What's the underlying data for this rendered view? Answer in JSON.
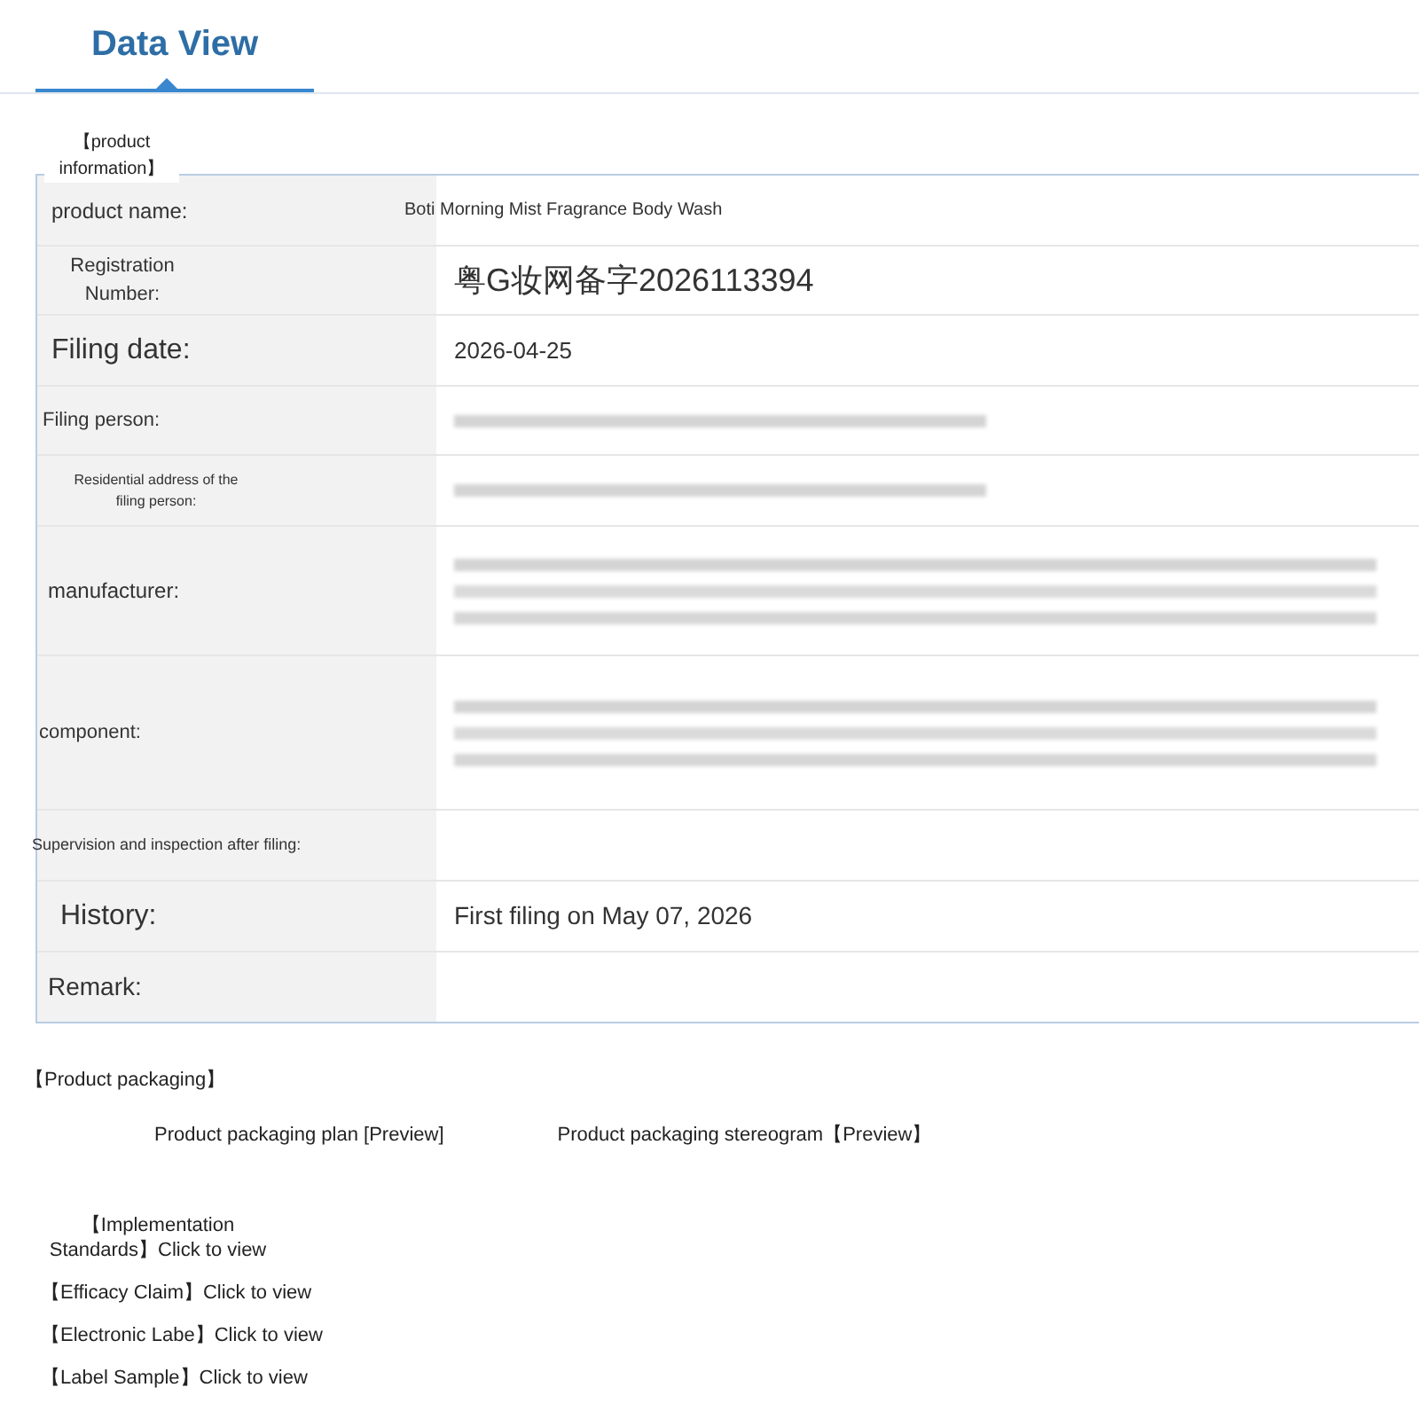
{
  "tabs": [
    {
      "label": "Data View",
      "selected": true
    }
  ],
  "product_information": {
    "legend": "【product information】",
    "rows": [
      {
        "label": "product name:",
        "value": "Boti Morning Mist Fragrance Body Wash"
      },
      {
        "label": "Registration Number:",
        "value": "粤G妆网备字2026113394"
      },
      {
        "label": "Filing date:",
        "value": "2026-04-25"
      },
      {
        "label": "Filing person:",
        "redacted": true
      },
      {
        "label": "Residential address of the filing person:",
        "redacted": true
      },
      {
        "label": "manufacturer:",
        "redacted": true
      },
      {
        "label": "component:",
        "redacted": true
      },
      {
        "label": "Supervision and inspection after filing:"
      },
      {
        "label": "History:",
        "value": "First filing on May 07, 2026"
      },
      {
        "label": "Remark:"
      }
    ]
  },
  "product_packaging": {
    "heading": "【Product packaging】",
    "links": [
      "Product packaging plan [Preview]",
      "Product packaging stereogram【Preview】"
    ]
  },
  "documents": [
    "【Implementation Standards】Click to view",
    "【Efficacy Claim】Click to view",
    "【Electronic Labe】Click to view",
    "【Label Sample】Click to view"
  ]
}
